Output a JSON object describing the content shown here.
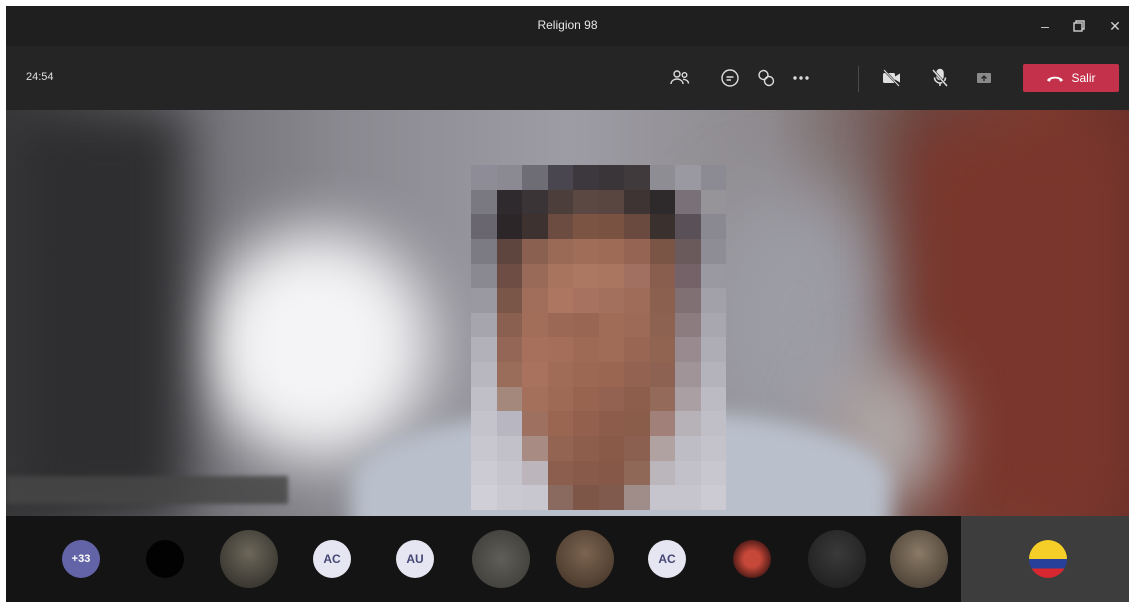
{
  "window": {
    "title": "Religion 98",
    "controls": [
      "minimize-icon",
      "restore-icon",
      "close-icon"
    ]
  },
  "toolbar": {
    "timer": "24:54",
    "icons": [
      "participants-icon",
      "chat-icon",
      "reactions-icon",
      "more-options-icon",
      "camera-off-icon",
      "microphone-off-icon",
      "share-screen-icon"
    ],
    "leave_label": "Salir",
    "leave_color": "#c4314b"
  },
  "participants": {
    "overflow_label": "+33",
    "initials": [
      "AC",
      "AU",
      "AC"
    ],
    "accent_color": "#6264a7"
  }
}
